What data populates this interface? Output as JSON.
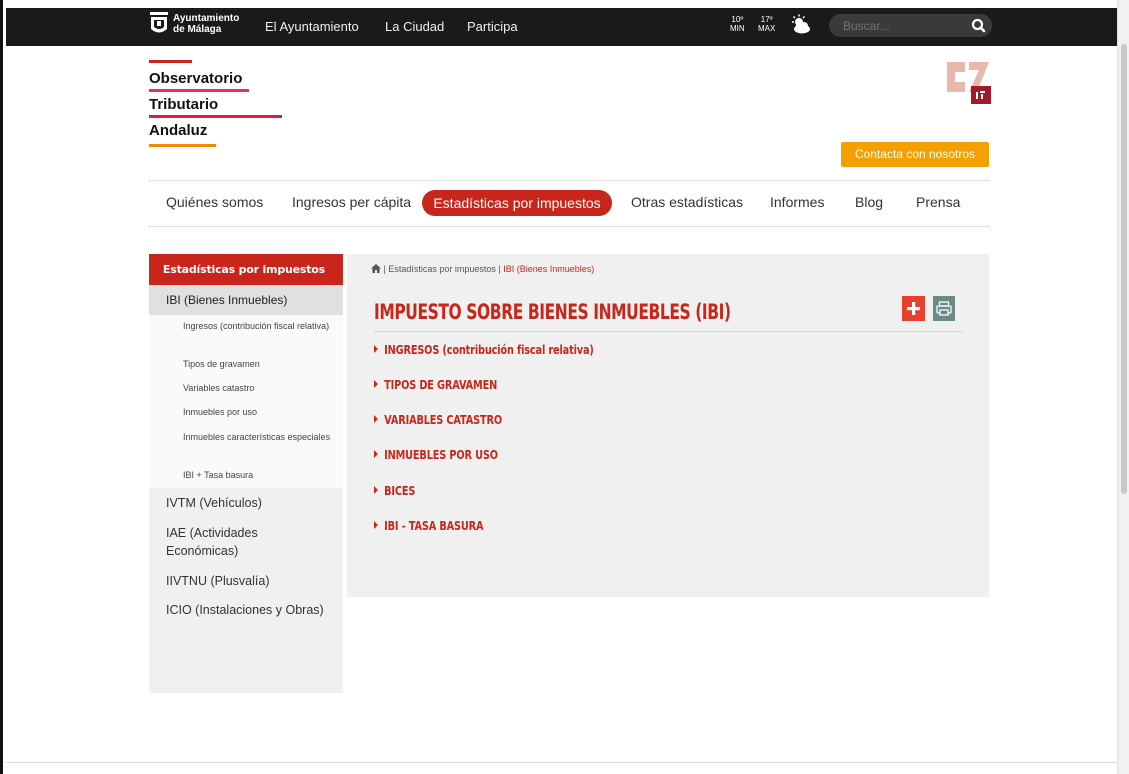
{
  "topbar": {
    "city_line1": "Ayuntamiento",
    "city_line2": "de Málaga",
    "nav": [
      "El Ayuntamiento",
      "La Ciudad",
      "Participa"
    ],
    "temp_min": "10º",
    "temp_min_label": "MIN",
    "temp_max": "17º",
    "temp_max_label": "MAX",
    "weather_icon": "partly-cloudy-icon",
    "search_placeholder": "Buscar...",
    "search_icon": "search-icon"
  },
  "logo": {
    "words": [
      "Observatorio",
      "Tributario",
      "Andaluz"
    ],
    "colors": [
      "#c8261b",
      "#e0306a",
      "#d92236",
      "#f08a00"
    ]
  },
  "header": {
    "contact_label": "Contacta con nosotros"
  },
  "mainnav": {
    "items": [
      "Quiénes somos",
      "Ingresos per cápita",
      "Estadísticas por impuestos",
      "Otras estadísticas",
      "Informes",
      "Blog",
      "Prensa"
    ],
    "active": "Estadísticas por impuestos"
  },
  "sidebar": {
    "title": "Estadísticas por impuestos",
    "current": "IBI (Bienes Inmuebles)",
    "subitems": [
      "Ingresos (contribución fiscal relativa)",
      "Tipos de gravamen",
      "Variables catastro",
      "Inmuebles por uso",
      "Inmuebles características especiales",
      "IBI + Tasa basura"
    ],
    "items": [
      "IVTM (Vehículos)",
      "IAE (Actividades Económicas)",
      "IIVTNU (Plusvalía)",
      "ICIO (Instalaciones y Obras)"
    ]
  },
  "content": {
    "breadcrumb_sep": " | ",
    "breadcrumb_section": "Estadísticas por impuestos",
    "breadcrumb_current": "IBI (Bienes Inmuebles)",
    "title": "IMPUESTO SOBRE BIENES INMUEBLES (IBI)",
    "sections": [
      "INGRESOS (contribución fiscal relativa)",
      "TIPOS DE GRAVAMEN",
      "VARIABLES CATASTRO",
      "INMUEBLES POR USO",
      "BICES",
      "IBI - TASA BASURA"
    ]
  },
  "colors": {
    "accent": "#c8261b",
    "contact": "#f4a000",
    "topbar": "#1a1a1a"
  }
}
